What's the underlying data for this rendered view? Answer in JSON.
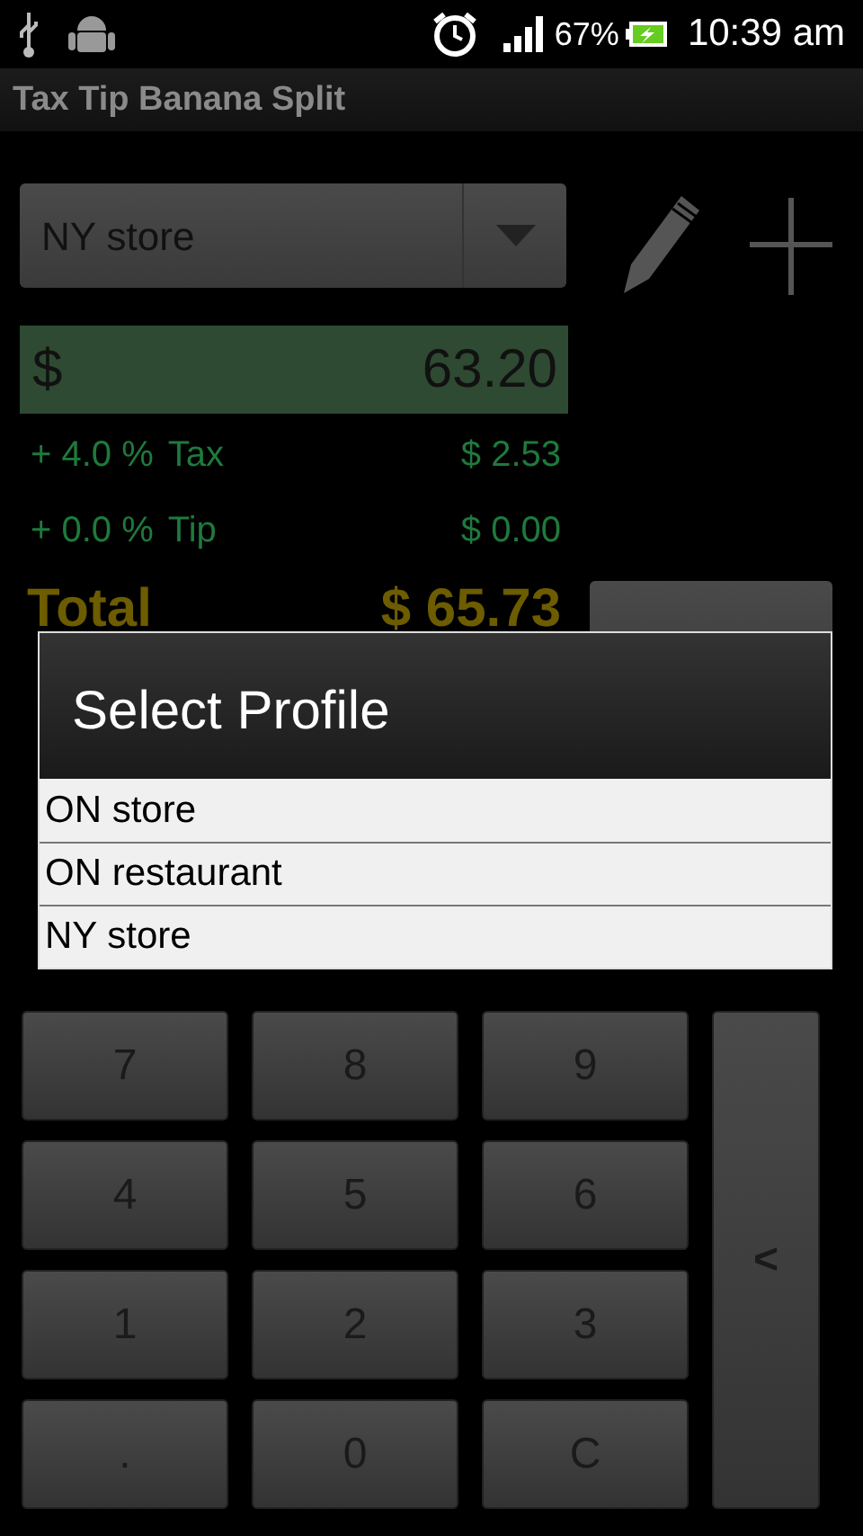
{
  "status_bar": {
    "battery": "67%",
    "time": "10:39 am"
  },
  "title": "Tax Tip Banana Split",
  "profile_spinner": {
    "value": "NY store"
  },
  "amount": {
    "currency": "$",
    "value": "63.20"
  },
  "lines": [
    {
      "percent": "+ 4.0 %",
      "label": "Tax",
      "amount": "$ 2.53"
    },
    {
      "percent": "+ 0.0 %",
      "label": "Tip",
      "amount": "$ 0.00"
    }
  ],
  "total": {
    "label": "Total",
    "amount": "$ 65.73"
  },
  "dialog": {
    "title": "Select Profile",
    "items": [
      "ON store",
      "ON restaurant",
      "NY store"
    ]
  },
  "keypad": [
    [
      "7",
      "8",
      "9"
    ],
    [
      "4",
      "5",
      "6"
    ],
    [
      "1",
      "2",
      "3"
    ],
    [
      ".",
      "0",
      "C"
    ]
  ],
  "backspace": "<"
}
